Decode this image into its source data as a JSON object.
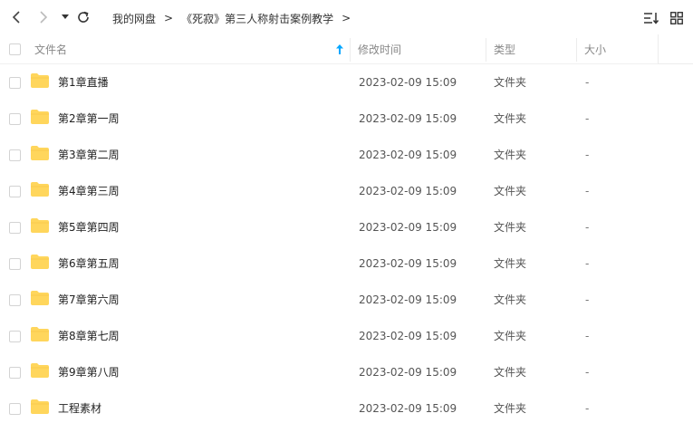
{
  "toolbar": {
    "back_icon": "chevron-left-icon",
    "forward_icon": "chevron-right-icon",
    "history_icon": "caret-down-icon",
    "refresh_icon": "refresh-icon",
    "sort_icon": "sort-icon",
    "grid_view_icon": "grid-view-icon"
  },
  "breadcrumb": {
    "items": [
      "我的网盘",
      "《死寂》第三人称射击案例教学"
    ],
    "separator": ">"
  },
  "table": {
    "headers": {
      "name": "文件名",
      "modified": "修改时间",
      "type": "类型",
      "size": "大小"
    },
    "sort_indicator_color": "#06a7ff",
    "folder_color": "#ffd65c",
    "rows": [
      {
        "name": "第1章直播",
        "modified": "2023-02-09 15:09",
        "type": "文件夹",
        "size": "-"
      },
      {
        "name": "第2章第一周",
        "modified": "2023-02-09 15:09",
        "type": "文件夹",
        "size": "-"
      },
      {
        "name": "第3章第二周",
        "modified": "2023-02-09 15:09",
        "type": "文件夹",
        "size": "-"
      },
      {
        "name": "第4章第三周",
        "modified": "2023-02-09 15:09",
        "type": "文件夹",
        "size": "-"
      },
      {
        "name": "第5章第四周",
        "modified": "2023-02-09 15:09",
        "type": "文件夹",
        "size": "-"
      },
      {
        "name": "第6章第五周",
        "modified": "2023-02-09 15:09",
        "type": "文件夹",
        "size": "-"
      },
      {
        "name": "第7章第六周",
        "modified": "2023-02-09 15:09",
        "type": "文件夹",
        "size": "-"
      },
      {
        "name": "第8章第七周",
        "modified": "2023-02-09 15:09",
        "type": "文件夹",
        "size": "-"
      },
      {
        "name": "第9章第八周",
        "modified": "2023-02-09 15:09",
        "type": "文件夹",
        "size": "-"
      },
      {
        "name": "工程素材",
        "modified": "2023-02-09 15:09",
        "type": "文件夹",
        "size": "-"
      }
    ]
  }
}
